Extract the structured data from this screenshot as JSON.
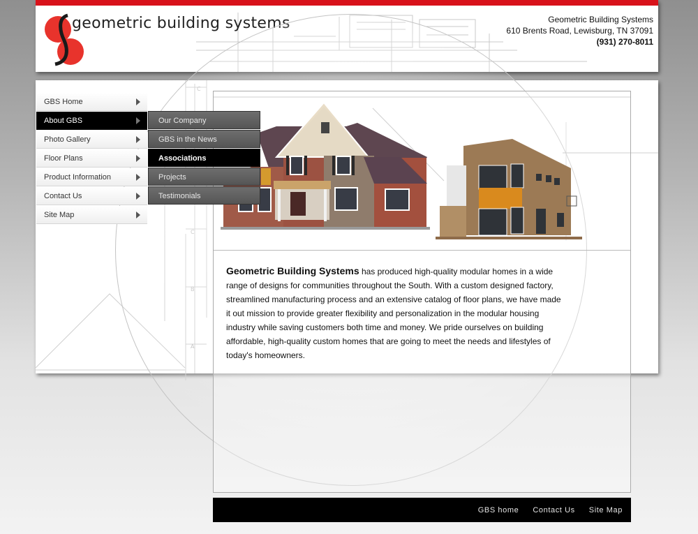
{
  "header": {
    "logo_text": "geometric building systems",
    "company_name": "Geometric Building Systems",
    "address": "610 Brents Road, Lewisburg, TN 37091",
    "phone": "(931) 270-8011"
  },
  "nav": {
    "items": [
      {
        "label": "GBS Home"
      },
      {
        "label": "About GBS",
        "active": true
      },
      {
        "label": "Photo Gallery"
      },
      {
        "label": "Floor Plans"
      },
      {
        "label": "Product Information"
      },
      {
        "label": "Contact Us"
      },
      {
        "label": "Site Map"
      }
    ]
  },
  "submenu": {
    "items": [
      {
        "label": "Our Company"
      },
      {
        "label": "GBS in the News"
      },
      {
        "label": "Associations",
        "active": true
      },
      {
        "label": "Projects"
      },
      {
        "label": "Testimonials"
      }
    ]
  },
  "intro": {
    "lead": "Geometric Building Systems",
    "body": " has produced high-quality modular homes in a wide range of designs for communities throughout the South.  With a custom designed factory, streamlined manufacturing process and an extensive catalog of floor plans, we have made it out mission to provide greater flexibility and personalization in the modular housing industry while saving customers both time and money.  We pride ourselves on building affordable, high-quality custom homes that are going to meet the needs and lifestyles of today's homeowners."
  },
  "footer": {
    "links": [
      {
        "label": "GBS home"
      },
      {
        "label": "Contact Us"
      },
      {
        "label": "Site Map"
      }
    ]
  },
  "blueprint_letters": [
    "C",
    "C",
    "B",
    "A"
  ],
  "colors": {
    "brand_red": "#d8121a",
    "logo_red": "#e8332c",
    "nav_active": "#000000",
    "submenu_bg": "#5f5f5f"
  }
}
